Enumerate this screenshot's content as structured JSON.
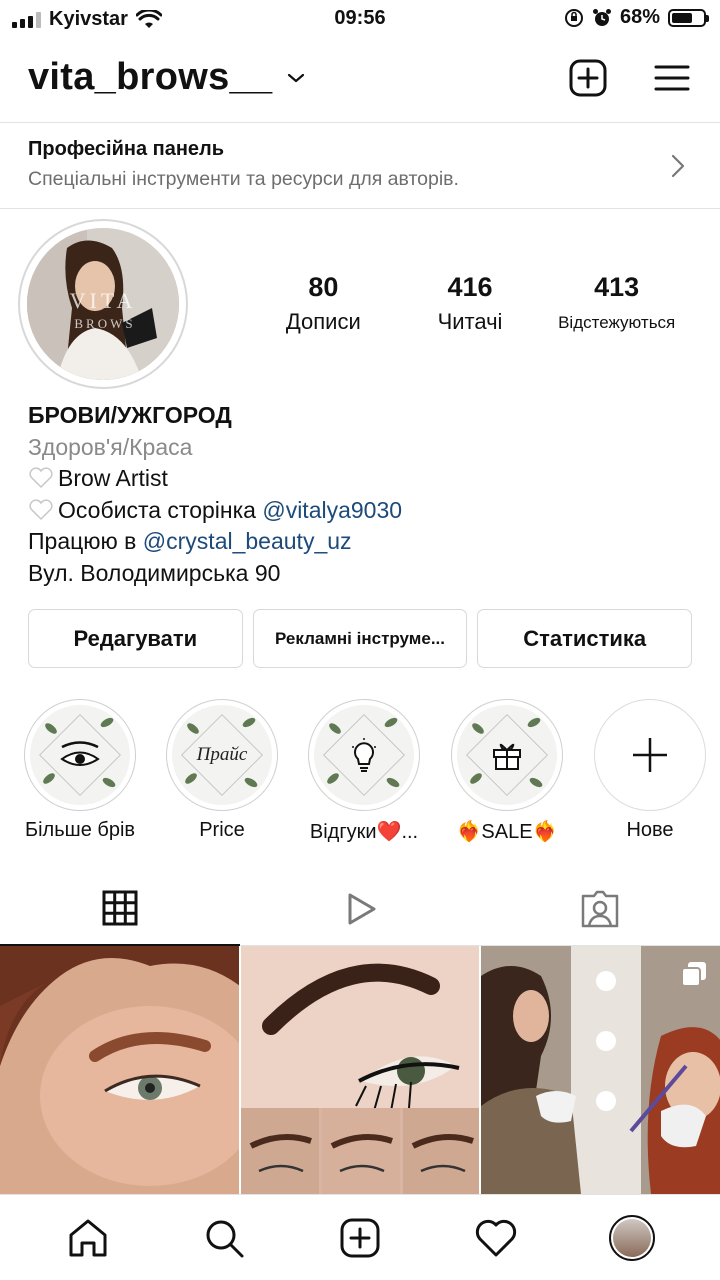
{
  "status_bar": {
    "carrier": "Kyivstar",
    "time": "09:56",
    "battery": "68%",
    "battery_level": 0.68
  },
  "header": {
    "username": "vita_brows__",
    "icons": [
      "chevron-down-icon",
      "new-post-icon",
      "menu-icon"
    ]
  },
  "pro_panel": {
    "title": "Професійна панель",
    "subtitle": "Спеціальні інструменти та ресурси для авторів."
  },
  "profile": {
    "avatar_text_1": "VITA",
    "avatar_text_2": "BROWS",
    "stats": [
      {
        "value": "80",
        "label": "Дописи"
      },
      {
        "value": "416",
        "label": "Читачі"
      },
      {
        "value": "413",
        "label": "Відстежуються"
      }
    ],
    "name": "БРОВИ/УЖГОРОД",
    "category": "Здоров'я/Краса",
    "bio": {
      "line1_text": "Brow Artist",
      "line2_text": "Особиста сторінка ",
      "line2_mention": "@vitalya9030",
      "line3_text": "Працюю в ",
      "line3_mention": "@crystal_beauty_uz",
      "line4_text": "Вул. Володимирська 90"
    }
  },
  "buttons": {
    "edit": "Редагувати",
    "ads": "Рекламні інструме...",
    "stats": "Статистика"
  },
  "highlights": [
    {
      "label": "Більше брів",
      "icon": "eye-brow-icon"
    },
    {
      "label": "Price",
      "icon": "price-tag-icon",
      "inner_text": "Прайс"
    },
    {
      "label": "Відгуки❤️...",
      "icon": "lightbulb-icon"
    },
    {
      "label": "❤️‍🔥SALE❤️‍🔥",
      "icon": "gift-icon"
    },
    {
      "label": "Нове",
      "icon": "plus-icon"
    }
  ],
  "tabs": [
    "grid-icon",
    "reels-icon",
    "tagged-icon"
  ],
  "bottom_nav": [
    "home-icon",
    "search-icon",
    "create-icon",
    "heart-icon",
    "profile-avatar"
  ],
  "colors": {
    "mention": "#1d4a7a",
    "secondary_text": "#6e6e6e",
    "border": "#d9d9d9"
  }
}
